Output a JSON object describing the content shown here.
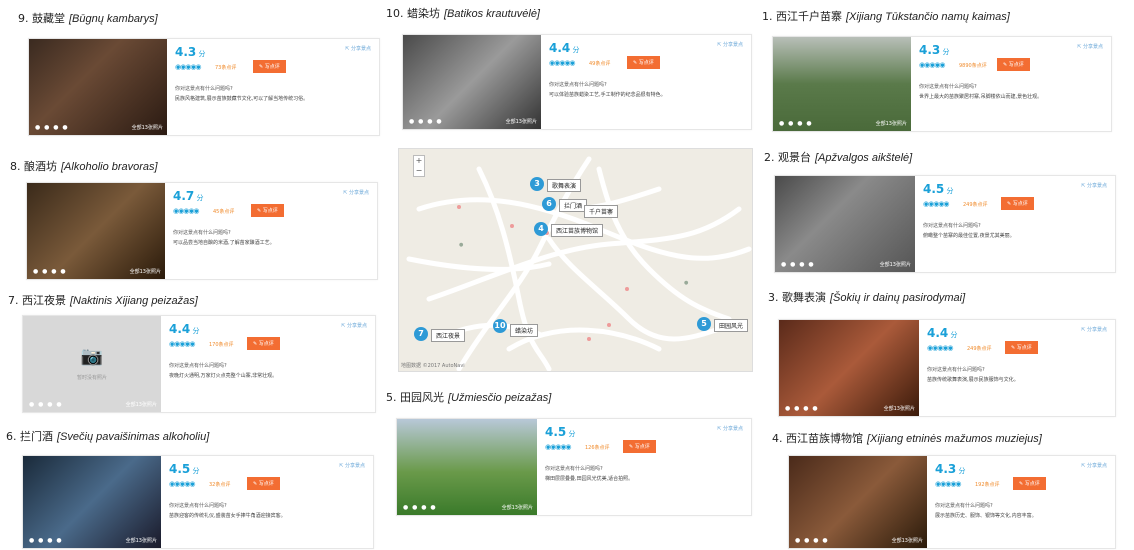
{
  "photo_more": "全部13张照片",
  "review_btn": "写点评",
  "share": "分享景点",
  "ask": "你对这景点有什么问题吗?",
  "map": {
    "zoom_in": "+",
    "zoom_out": "−",
    "copyright": "地图数据 ©2017 AutoNavi",
    "labels": {
      "p3": "歌舞表演",
      "p6": "拦门酒",
      "p6b": "千户苗寨",
      "p4": "西江苗族博物馆",
      "p7": "西江夜景",
      "p10": "蜡染坊",
      "p5": "田园风光"
    }
  },
  "places": [
    {
      "num": "9.",
      "name": "鼓藏堂",
      "tr": "[Būgnų kambarys]",
      "rating": "4.3",
      "reviews": "73条点评",
      "tip": "民族风格建筑,展示苗族鼓藏节文化,可以了解当地传统习俗。"
    },
    {
      "num": "10.",
      "name": "蜡染坊",
      "tr": "[Batikos krautuvėlė]",
      "rating": "4.4",
      "reviews": "49条点评",
      "tip": "可以体验苗族蜡染工艺,手工制作的纪念品很有特色。"
    },
    {
      "num": "1.",
      "name": "西江千户苗寨",
      "tr": "[Xijiang Tūkstančio namų kaimas]",
      "rating": "4.3",
      "reviews": "9890条点评",
      "tip": "世界上最大的苗族聚居村寨,吊脚楼依山而建,景色壮观。"
    },
    {
      "num": "8.",
      "name": "酿酒坊",
      "tr": "[Alkoholio bravoras]",
      "rating": "4.7",
      "reviews": "45条点评",
      "tip": "可以品尝当地自酿的米酒,了解苗家酿酒工艺。"
    },
    {
      "num": "2.",
      "name": "观景台",
      "tr": "[Apžvalgos aikštelė]",
      "rating": "4.5",
      "reviews": "249条点评",
      "tip": "俯瞰整个苗寨的最佳位置,夜景尤其美丽。"
    },
    {
      "num": "7.",
      "name": "西江夜景",
      "tr": "[Naktinis Xijiang peizažas]",
      "rating": "4.4",
      "reviews": "170条点评",
      "tip": "夜晚灯火通明,万家灯火点亮整个山寨,非常壮观。"
    },
    {
      "num": "3.",
      "name": "歌舞表演",
      "tr": "[Šokių ir dainų pasirodymai]",
      "rating": "4.4",
      "reviews": "249条点评",
      "tip": "苗族传统歌舞表演,展示民族服饰与文化。"
    },
    {
      "num": "5.",
      "name": "田园风光",
      "tr": "[Užmiesčio peizažas]",
      "rating": "4.5",
      "reviews": "126条点评",
      "tip": "梯田层层叠叠,田园风光优美,适合拍照。"
    },
    {
      "num": "6.",
      "name": "拦门酒",
      "tr": "[Svečių pavaišinimas alkoholiu]",
      "rating": "4.5",
      "reviews": "32条点评",
      "tip": "苗族迎客的传统礼仪,盛装苗女手捧牛角酒迎接宾客。"
    },
    {
      "num": "4.",
      "name": "西江苗族博物馆",
      "tr": "[Xijiang etninės mažumos muziejus]",
      "rating": "4.3",
      "reviews": "192条点评",
      "tip": "展示苗族历史、服饰、银饰等文化,内容丰富。"
    }
  ],
  "photo_placeholder": "暂时没有照片"
}
